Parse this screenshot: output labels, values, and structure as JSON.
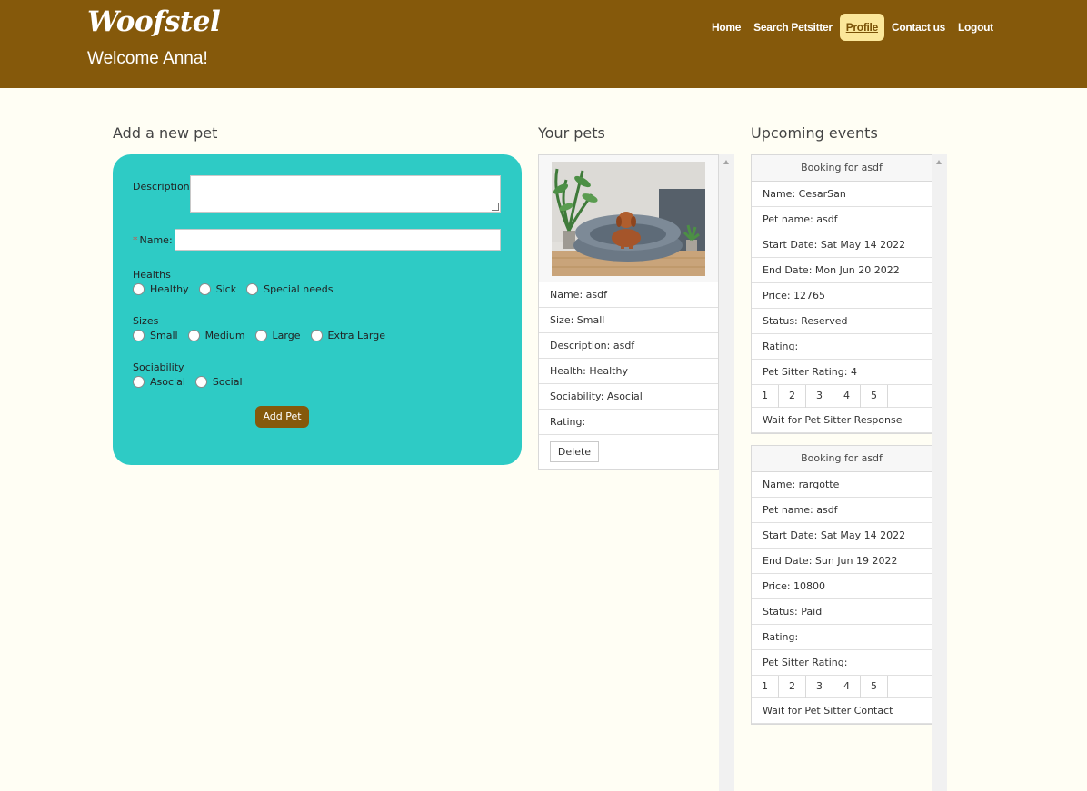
{
  "header": {
    "logo": "Woofstel",
    "welcome": "Welcome Anna!",
    "nav": [
      "Home",
      "Search Petsitter",
      "Profile",
      "Contact us",
      "Logout"
    ],
    "active_nav": "Profile"
  },
  "add_pet": {
    "title": "Add a new pet",
    "description_label": "Description:",
    "description_value": "",
    "name_label": "Name:",
    "name_value": "",
    "healths_label": "Healths",
    "healths": [
      "Healthy",
      "Sick",
      "Special needs"
    ],
    "sizes_label": "Sizes",
    "sizes": [
      "Small",
      "Medium",
      "Large",
      "Extra Large"
    ],
    "sociability_label": "Sociability",
    "sociability": [
      "Asocial",
      "Social"
    ],
    "submit": "Add Pet"
  },
  "your_pets": {
    "title": "Your pets",
    "pets": [
      {
        "photo": "dog-on-bed-photo",
        "rows": [
          "Name: asdf",
          "Size: Small",
          "Description: asdf",
          "Health: Healthy",
          "Sociability: Asocial",
          "Rating:"
        ],
        "delete": "Delete"
      }
    ]
  },
  "events": {
    "title": "Upcoming events",
    "items": [
      {
        "header": "Booking for asdf",
        "rows": [
          "Name: CesarSan",
          "Pet name: asdf",
          "Start Date: Sat May 14 2022",
          "End Date: Mon Jun 20 2022",
          "Price: 12765",
          "Status: Reserved",
          "Rating:",
          "Pet Sitter Rating: 4"
        ],
        "ratings": [
          "1",
          "2",
          "3",
          "4",
          "5"
        ],
        "footer": "Wait for Pet Sitter Response"
      },
      {
        "header": "Booking for asdf",
        "rows": [
          "Name: rargotte",
          "Pet name: asdf",
          "Start Date: Sat May 14 2022",
          "End Date: Sun Jun 19 2022",
          "Price: 10800",
          "Status: Paid",
          "Rating:",
          "Pet Sitter Rating:"
        ],
        "ratings": [
          "1",
          "2",
          "3",
          "4",
          "5"
        ],
        "footer": "Wait for Pet Sitter Contact"
      }
    ]
  }
}
